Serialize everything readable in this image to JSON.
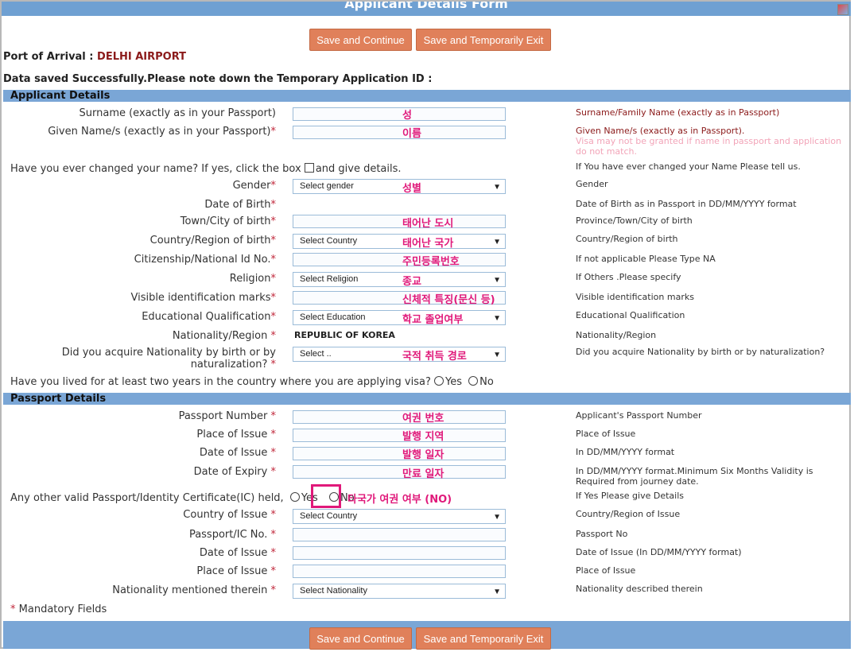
{
  "form_title": "Applicant Details Form",
  "buttons": {
    "save_continue": "Save and Continue",
    "save_exit": "Save and Temporarily Exit"
  },
  "port": {
    "label": "Port of Arrival :",
    "value": "DELHI AIRPORT"
  },
  "saved_message": "Data saved Successfully.Please note down the Temporary Application ID :",
  "sections": {
    "applicant": "Applicant Details",
    "passport": "Passport Details"
  },
  "applicant": {
    "surname": {
      "label": "Surname (exactly as in your Passport)",
      "annotation": "성",
      "help": "Surname/Family Name (exactly as in Passport)"
    },
    "given_name": {
      "label": "Given Name/s (exactly as in your Passport)",
      "req": "*",
      "annotation": "이름",
      "help": "Given Name/s (exactly as in Passport).",
      "help2": "Visa may not be granted if name in passport and application",
      "help3": "do not match."
    },
    "changed_name": {
      "label": "Have you ever changed your name? If yes, click the box",
      "after": "and give details.",
      "help": "If You have ever changed your Name Please tell us."
    },
    "gender": {
      "label": "Gender",
      "req": "*",
      "select": "Select gender",
      "annotation": "성별",
      "help": "Gender"
    },
    "dob": {
      "label": "Date of Birth",
      "req": "*",
      "help": "Date of Birth as in Passport in DD/MM/YYYY format"
    },
    "town": {
      "label": "Town/City of birth",
      "req": "*",
      "annotation": "태어난 도시",
      "help": "Province/Town/City of birth"
    },
    "country": {
      "label": "Country/Region of birth",
      "req": "*",
      "select": "Select Country",
      "annotation": "태어난 국가",
      "help": "Country/Region of birth"
    },
    "citizenship": {
      "label": "Citizenship/National Id No.",
      "req": "*",
      "annotation": "주민등록번호",
      "help": "If not applicable Please Type NA"
    },
    "religion": {
      "label": "Religion",
      "req": "*",
      "select": "Select Religion",
      "annotation": "종교",
      "help": "If Others .Please specify"
    },
    "marks": {
      "label": "Visible identification marks",
      "req": "*",
      "annotation": "신체적 특징(문신 등)",
      "help": "Visible identification marks"
    },
    "education": {
      "label": "Educational Qualification",
      "req": "*",
      "select": "Select Education",
      "annotation": "학교 졸업여부",
      "help": "Educational Qualification"
    },
    "nationality": {
      "label": "Nationality/Region",
      "req": "*",
      "value": "REPUBLIC OF KOREA",
      "help": "Nationality/Region"
    },
    "acquire": {
      "label": "Did you acquire Nationality by birth or by",
      "label2": "naturalization?",
      "req": "*",
      "select": "Select ..",
      "annotation": "국적 취득 경로",
      "help": "Did you acquire Nationality by birth or by naturalization?"
    },
    "lived": {
      "label": "Have you lived for at least two years in the country where you are applying visa?",
      "yes": "Yes",
      "no": "No"
    }
  },
  "passport": {
    "number": {
      "label": "Passport Number",
      "req": "*",
      "annotation": "여권 번호",
      "help": "Applicant's Passport Number"
    },
    "place": {
      "label": "Place of Issue",
      "req": "*",
      "annotation": "발행 지역",
      "help": "Place of Issue"
    },
    "issue_date": {
      "label": "Date of Issue",
      "req": "*",
      "annotation": "발행 일자",
      "help": "In DD/MM/YYYY format"
    },
    "expiry": {
      "label": "Date of Expiry",
      "req": "*",
      "annotation": "만료 일자",
      "help": "In DD/MM/YYYY format.Minimum Six Months Validity is",
      "help2": "Required from journey date."
    },
    "other": {
      "label": "Any other valid Passport/Identity Certificate(IC) held,",
      "yes": "Yes",
      "no": "No",
      "annotation": "타국가 여권 여부 (NO)",
      "help": "If Yes Please give Details"
    },
    "ic_country": {
      "label": "Country of Issue",
      "req": "*",
      "select": "Select Country",
      "help": "Country/Region of Issue"
    },
    "ic_no": {
      "label": "Passport/IC No.",
      "req": "*",
      "help": "Passport No"
    },
    "ic_date": {
      "label": "Date of Issue",
      "req": "*",
      "help": "Date of Issue (In DD/MM/YYYY format)"
    },
    "ic_place": {
      "label": "Place of Issue",
      "req": "*",
      "help": "Place of Issue"
    },
    "ic_nationality": {
      "label": "Nationality mentioned therein",
      "req": "*",
      "select": "Select Nationality",
      "help": "Nationality described therein"
    }
  },
  "mandatory": {
    "star": "*",
    "text": "Mandatory Fields"
  }
}
